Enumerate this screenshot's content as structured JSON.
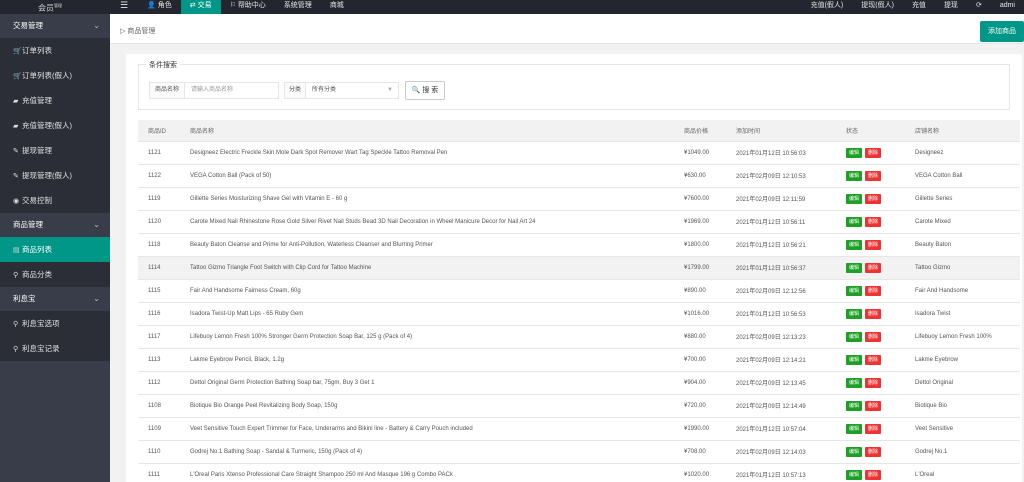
{
  "logo": {
    "text": "会员",
    "sup": "管理"
  },
  "top_nav": [
    {
      "label": "角色",
      "icon": "person-icon",
      "glyph": "👤",
      "active": false
    },
    {
      "label": "交易",
      "icon": "transaction-icon",
      "glyph": "⇄",
      "active": true
    },
    {
      "label": "帮助中心",
      "icon": "flag-icon",
      "glyph": "⚐",
      "active": false
    },
    {
      "label": "系统管理",
      "icon": "",
      "glyph": "",
      "active": false
    },
    {
      "label": "商城",
      "icon": "",
      "glyph": "",
      "active": false
    }
  ],
  "menu_icon": "☰",
  "top_right": [
    {
      "label": "充值(假人)"
    },
    {
      "label": "提现(假人)"
    },
    {
      "label": "充值"
    },
    {
      "label": "提现"
    },
    {
      "label": "⟳",
      "icon": "refresh-icon"
    },
    {
      "label": "admi",
      "icon": "user-icon"
    }
  ],
  "sidebar": [
    {
      "type": "group",
      "label": "交易管理"
    },
    {
      "type": "item",
      "label": "订单列表",
      "glyph": "🛒"
    },
    {
      "type": "item",
      "label": "订单列表(假人)",
      "glyph": "🛒"
    },
    {
      "type": "item",
      "label": "充值管理",
      "glyph": "▰"
    },
    {
      "type": "item",
      "label": "充值管理(假人)",
      "glyph": "▰"
    },
    {
      "type": "item",
      "label": "提现管理",
      "glyph": "✎"
    },
    {
      "type": "item",
      "label": "提现管理(假人)",
      "glyph": "✎"
    },
    {
      "type": "item",
      "label": "交易控制",
      "glyph": "◉"
    },
    {
      "type": "group",
      "label": "商品管理"
    },
    {
      "type": "item",
      "label": "商品列表",
      "glyph": "▤",
      "active": true
    },
    {
      "type": "item",
      "label": "商品分类",
      "glyph": "⚲"
    },
    {
      "type": "group",
      "label": "利息宝"
    },
    {
      "type": "item",
      "label": "利息宝选项",
      "glyph": "⚲"
    },
    {
      "type": "item",
      "label": "利息宝记录",
      "glyph": "⚲"
    }
  ],
  "breadcrumb": "▷ 商品管理",
  "add_button": "添加商品",
  "search": {
    "legend": "条件搜索",
    "name_label": "商品名称",
    "name_placeholder": "请输入商品名称",
    "category_label": "分类",
    "category_value": "所有分类",
    "button": "搜 索"
  },
  "table": {
    "headers": [
      "商品ID",
      "商品名称",
      "商品价格",
      "添加时间",
      "状态",
      "店铺名称"
    ],
    "edit_label": "编辑",
    "delete_label": "删除",
    "rows": [
      {
        "id": "1121",
        "name": "Designeez Electric Freckle Skin Mole Dark Spot Remover Wart Tag Speckle Tattoo Removal Pen",
        "price": "¥1049.00",
        "time": "2021年01月12日 10:56:03",
        "shop": "Designeez"
      },
      {
        "id": "1122",
        "name": "VEGA Cotton Ball (Pack of 50)",
        "price": "¥630.00",
        "time": "2021年02月09日 12:10:53",
        "shop": "VEGA Cotton Ball"
      },
      {
        "id": "1119",
        "name": "Gillette Series Moisturizing Shave Gel with Vitamin E - 60 g",
        "price": "¥7600.00",
        "time": "2021年02月09日 12:11:59",
        "shop": "Gillette Series"
      },
      {
        "id": "1120",
        "name": "Carote Mixed Nail Rhinestone Rose Gold Silver Rivet Nail Studs Bead 3D Nail Decoration in Wheel Manicure Decor for Nail Art 24",
        "price": "¥1969.00",
        "time": "2021年01月12日 10:56:11",
        "shop": "Carote Mixed"
      },
      {
        "id": "1118",
        "name": "Beauty Baton Cleanse and Prime for Anti-Pollution, Waterless Cleanser and Blurring Primer",
        "price": "¥1800.00",
        "time": "2021年01月12日 10:56:21",
        "shop": "Beauty Baton"
      },
      {
        "id": "1114",
        "name": "Tattoo Gizmo Triangle Foot Switch with Clip Cord for Tattoo Machine",
        "price": "¥1799.00",
        "time": "2021年01月12日 10:56:37",
        "shop": "Tattoo Gizmo",
        "hover": true
      },
      {
        "id": "1115",
        "name": "Fair And Handsome Fairness Cream, 60g",
        "price": "¥890.00",
        "time": "2021年02月09日 12:12:56",
        "shop": "Fair And Handsome"
      },
      {
        "id": "1116",
        "name": "Isadora Twist-Up Matt Lips - 65 Ruby Gem",
        "price": "¥1016.00",
        "time": "2021年01月12日 10:56:53",
        "shop": "Isadora Twist"
      },
      {
        "id": "1117",
        "name": "Lifebuoy Lemon Fresh 100% Stronger Germ Protection Soap Bar, 125 g (Pack of 4)",
        "price": "¥880.00",
        "time": "2021年02月09日 12:13:23",
        "shop": "Lifebuoy Lemon Fresh 100%"
      },
      {
        "id": "1113",
        "name": "Lakme Eyebrow Pencil, Black, 1.2g",
        "price": "¥700.00",
        "time": "2021年02月09日 12:14:21",
        "shop": "Lakme Eyebrow"
      },
      {
        "id": "1112",
        "name": "Dettol Original Germ Protection Bathing Soap bar, 75gm, Buy 3 Get 1",
        "price": "¥904.00",
        "time": "2021年02月09日 12:13:45",
        "shop": "Dettol Original"
      },
      {
        "id": "1108",
        "name": "Biotique Bio Orange Peel Revitalizing Body Soap, 150g",
        "price": "¥720.00",
        "time": "2021年02月09日 12:14:49",
        "shop": "Biotique Bio"
      },
      {
        "id": "1109",
        "name": "Veet Sensitive Touch Expert Trimmer for Face, Underarms and Bikini line - Battery & Carry Pouch included",
        "price": "¥1990.00",
        "time": "2021年01月12日 10:57:04",
        "shop": "Veet Sensitive"
      },
      {
        "id": "1110",
        "name": "Godrej No.1 Bathing Soap - Sandal & Turmeric, 150g (Pack of 4)",
        "price": "¥708.00",
        "time": "2021年02月09日 12:14:03",
        "shop": "Godrej No.1"
      },
      {
        "id": "1111",
        "name": "L'Oreal Paris Xtenso Professional Care Straight Shampoo 250 ml And Masque 196 g Combo PACk",
        "price": "¥1020.00",
        "time": "2021年01月12日 10:57:13",
        "shop": "L'Oreal"
      }
    ]
  }
}
